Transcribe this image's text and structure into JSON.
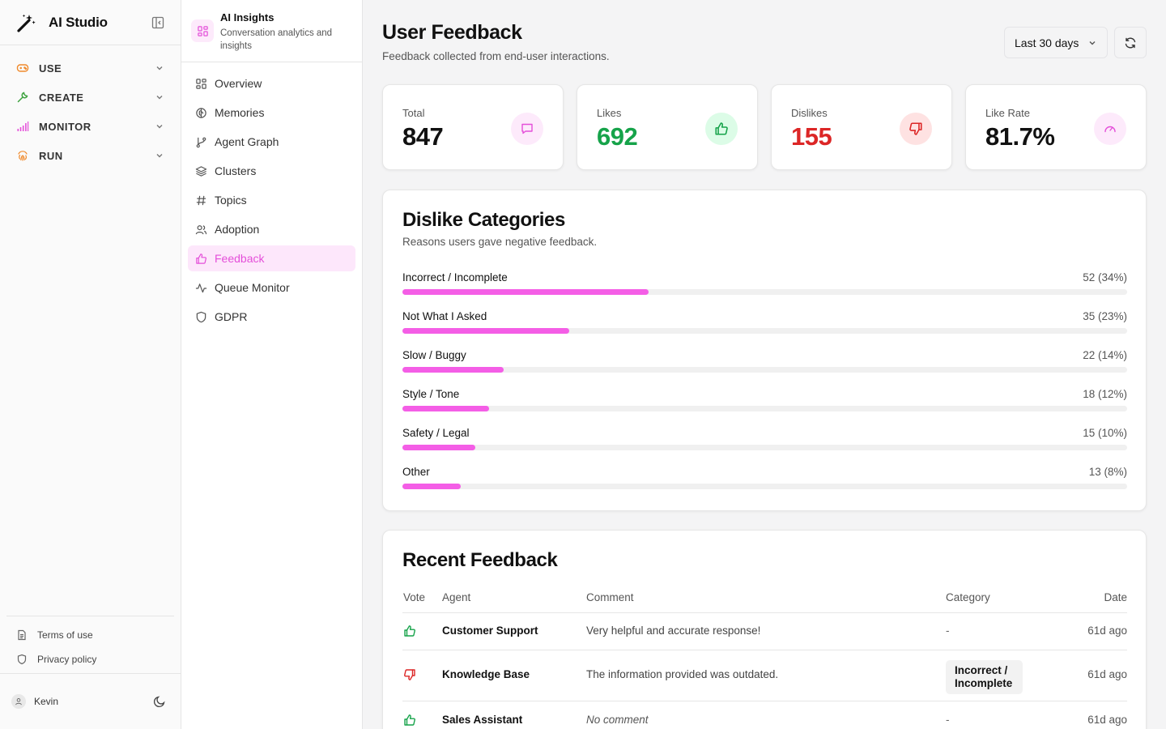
{
  "app": {
    "name": "AI Studio"
  },
  "sidebar": {
    "groups": [
      {
        "label": "USE",
        "icon": "gamepad-icon",
        "color": "#f08a2c"
      },
      {
        "label": "CREATE",
        "icon": "wrench-icon",
        "color": "#3da23f"
      },
      {
        "label": "MONITOR",
        "icon": "signal-bars-icon",
        "color": "#e44fd9"
      },
      {
        "label": "RUN",
        "icon": "fingerprint-icon",
        "color": "#f08a2c"
      }
    ],
    "footer_links": [
      {
        "label": "Terms of use",
        "icon": "document-icon"
      },
      {
        "label": "Privacy policy",
        "icon": "shield-icon"
      }
    ],
    "user": {
      "name": "Kevin"
    }
  },
  "subnav": {
    "title": "AI Insights",
    "subtitle": "Conversation analytics and insights",
    "items": [
      {
        "label": "Overview",
        "icon": "grid-icon",
        "active": false
      },
      {
        "label": "Memories",
        "icon": "brain-icon",
        "active": false
      },
      {
        "label": "Agent Graph",
        "icon": "git-branch-icon",
        "active": false
      },
      {
        "label": "Clusters",
        "icon": "layers-icon",
        "active": false
      },
      {
        "label": "Topics",
        "icon": "hash-icon",
        "active": false
      },
      {
        "label": "Adoption",
        "icon": "users-icon",
        "active": false
      },
      {
        "label": "Feedback",
        "icon": "thumbs-up-icon",
        "active": true
      },
      {
        "label": "Queue Monitor",
        "icon": "activity-icon",
        "active": false
      },
      {
        "label": "GDPR",
        "icon": "shield-icon",
        "active": false
      }
    ]
  },
  "header": {
    "title": "User Feedback",
    "subtitle": "Feedback collected from end-user interactions.",
    "range": "Last 30 days"
  },
  "stats": [
    {
      "label": "Total",
      "value": "847",
      "color": "#111111",
      "icon": "message-icon",
      "icon_color": "#e44fd9",
      "icon_bg": "#fdeafb"
    },
    {
      "label": "Likes",
      "value": "692",
      "color": "#16a34a",
      "icon": "thumbs-up-icon",
      "icon_color": "#16a34a",
      "icon_bg": "#dcfce7"
    },
    {
      "label": "Dislikes",
      "value": "155",
      "color": "#dc2626",
      "icon": "thumbs-down-icon",
      "icon_color": "#dc2626",
      "icon_bg": "#fee2e2"
    },
    {
      "label": "Like Rate",
      "value": "81.7%",
      "color": "#111111",
      "icon": "gauge-icon",
      "icon_color": "#e44fd9",
      "icon_bg": "#fdeafb"
    }
  ],
  "categories": {
    "title": "Dislike Categories",
    "subtitle": "Reasons users gave negative feedback.",
    "accent": "#f45ee6",
    "items": [
      {
        "name": "Incorrect / Incomplete",
        "value": "52 (34%)",
        "share": 0.34
      },
      {
        "name": "Not What I Asked",
        "value": "35 (23%)",
        "share": 0.23
      },
      {
        "name": "Slow / Buggy",
        "value": "22 (14%)",
        "share": 0.14
      },
      {
        "name": "Style / Tone",
        "value": "18 (12%)",
        "share": 0.12
      },
      {
        "name": "Safety / Legal",
        "value": "15 (10%)",
        "share": 0.1
      },
      {
        "name": "Other",
        "value": "13 (8%)",
        "share": 0.08
      }
    ]
  },
  "recent": {
    "title": "Recent Feedback",
    "columns": {
      "vote": "Vote",
      "agent": "Agent",
      "comment": "Comment",
      "category": "Category",
      "date": "Date"
    },
    "rows": [
      {
        "vote": "like",
        "agent": "Customer Support",
        "comment": "Very helpful and accurate response!",
        "category": "-",
        "date": "61d ago"
      },
      {
        "vote": "dislike",
        "agent": "Knowledge Base",
        "comment": "The information provided was outdated.",
        "category": "Incorrect / Incomplete",
        "date": "61d ago"
      },
      {
        "vote": "like",
        "agent": "Sales Assistant",
        "comment": "No comment",
        "category": "-",
        "date": "61d ago"
      }
    ]
  }
}
